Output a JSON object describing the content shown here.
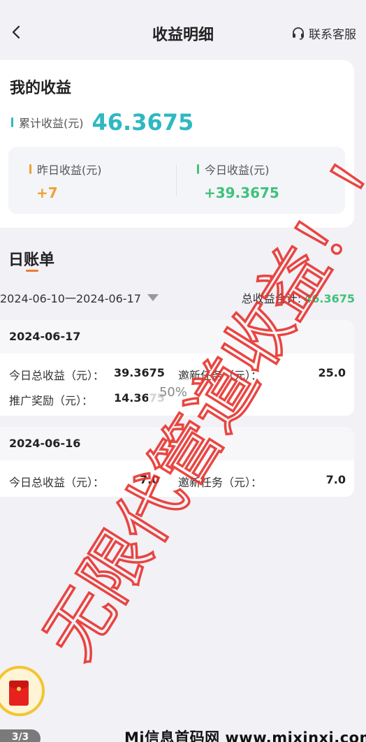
{
  "header": {
    "title": "收益明细",
    "service_label": "联系客服"
  },
  "summary": {
    "title": "我的收益",
    "total_label": "累计收益(元)",
    "total_value": "46.3675",
    "yesterday_label": "昨日收益(元)",
    "yesterday_value": "+7",
    "today_label": "今日收益(元)",
    "today_value": "+39.3675"
  },
  "ledger": {
    "title": "日账单",
    "date_range": "2024-06-10一2024-06-17",
    "sum_label": "总收益合计:",
    "sum_value": "46.3675"
  },
  "days": [
    {
      "date": "2024-06-17",
      "rows": [
        {
          "label": "今日总收益（元）：",
          "value": "39.3675"
        },
        {
          "label": "邀新任务（元）：",
          "value": "25.0"
        },
        {
          "label": "推广奖励（元）：",
          "value": "14.3675"
        }
      ]
    },
    {
      "date": "2024-06-16",
      "rows": [
        {
          "label": "今日总收益（元）：",
          "value": "7.0"
        },
        {
          "label": "邀新任务（元）：",
          "value": "7.0"
        }
      ]
    }
  ],
  "overlay": {
    "percent": "50%",
    "watermark": "无限代管道收益！！",
    "pager": "3/3",
    "bottom_watermark": "Mi信息首码网 www.mixinxi.com"
  },
  "colors": {
    "total": "#2fb8c1",
    "yesterday": "#f0a030",
    "today": "#3fc27a",
    "watermark": "#e8322d"
  }
}
